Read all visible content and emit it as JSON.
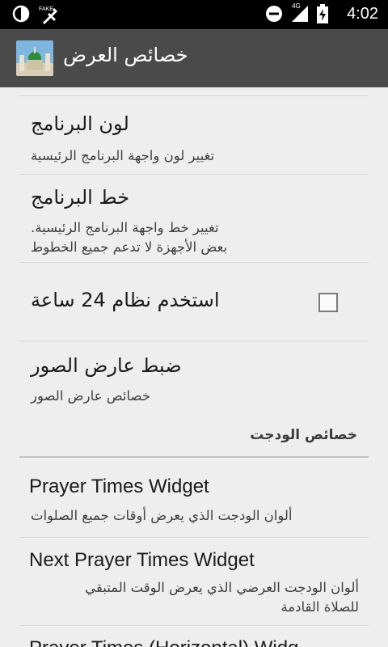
{
  "status_bar": {
    "left_icons": [
      "data-saver-icon",
      "sim-fake-icon"
    ],
    "network_label": "4G",
    "time": "4:02"
  },
  "action_bar": {
    "title": "خصائص العرض"
  },
  "settings": [
    {
      "title": "لون البرنامج",
      "summary": [
        "تغيير لون واجهة البرنامج الرئيسية"
      ]
    },
    {
      "title": "خط البرنامج",
      "summary": [
        "تغيير خط واجهة البرنامج الرئيسية.",
        "بعض الأجهزة لا تدعم جميع الخطوط"
      ]
    },
    {
      "title": "استخدم نظام 24 ساعة",
      "checked": false
    },
    {
      "title": "ضبط عارض الصور",
      "summary": [
        "خصائص عارض الصور"
      ]
    }
  ],
  "widgets_section": {
    "header": "خصائص الودجت",
    "items": [
      {
        "title": "Prayer Times Widget",
        "summary": [
          "ألوان الودجت الذي يعرض أوقات جميع الصلوات"
        ]
      },
      {
        "title": "Next Prayer Times Widget",
        "summary": [
          "ألوان الودجت العرضي الذي يعرض الوقت المتبقي",
          "للصلاة القادمة"
        ]
      },
      {
        "title": "Prayer Times (Horizontal) Widg"
      }
    ]
  }
}
